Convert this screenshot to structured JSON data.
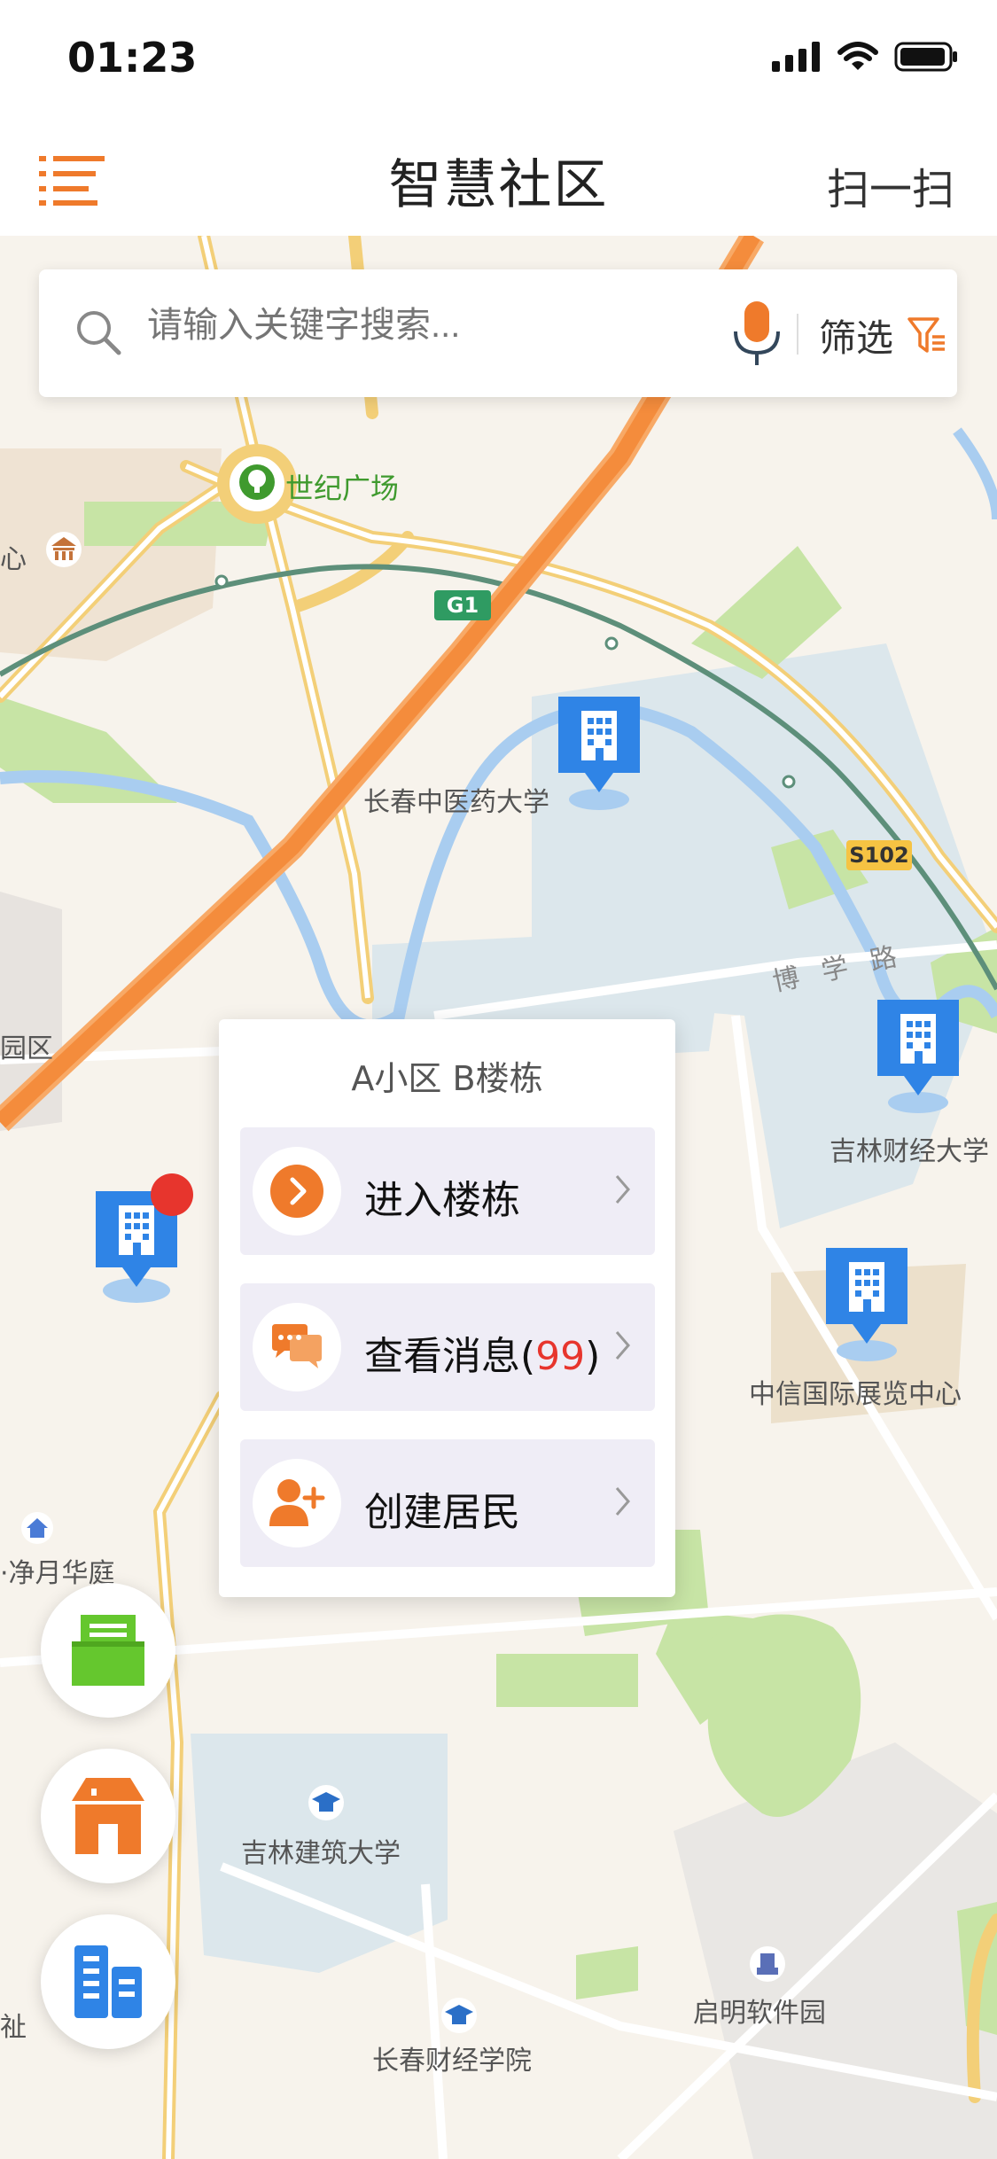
{
  "status": {
    "time": "01:23"
  },
  "nav": {
    "title": "智慧社区",
    "scan_label": "扫一扫"
  },
  "search": {
    "placeholder": "请输入关键字搜索...",
    "filter_label": "筛选"
  },
  "map": {
    "labels": {
      "century_square": "世纪广场",
      "g1": "G1",
      "s102": "S102",
      "tcm_university": "长春中医药大学",
      "boxue_road": "博学路",
      "jufe": "吉林财经大学",
      "citic": "中信国际展览中心",
      "jingyue": "·净月华庭",
      "jianzhu": "吉林建筑大学",
      "caijing": "长春财经学院",
      "qiming": "启明软件园",
      "left_xin": "心",
      "left_yuanqu": "园区",
      "left_zhi": "祉"
    }
  },
  "popup": {
    "title": "A小区 B楼栋",
    "items": [
      {
        "label": "进入楼栋",
        "icon": "chevron-right-circle-icon"
      },
      {
        "label": "查看消息(",
        "count": "99",
        "suffix": ")",
        "icon": "chat-icon"
      },
      {
        "label": "创建居民",
        "icon": "add-user-icon"
      }
    ]
  },
  "colors": {
    "accent": "#ef7a2b",
    "pin_blue": "#2f84e6",
    "fab_green": "#65c72e",
    "badge_red": "#e7352d"
  }
}
